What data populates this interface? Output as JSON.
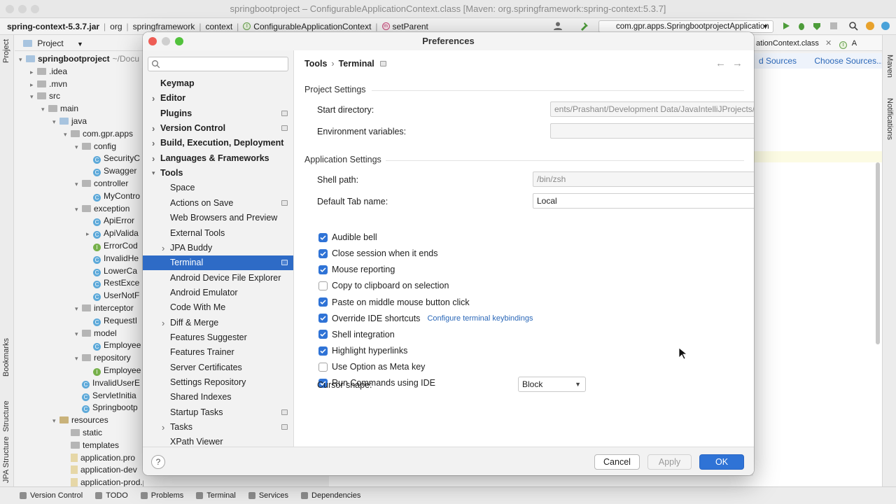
{
  "ide": {
    "window_title": "springbootproject – ConfigurableApplicationContext.class [Maven: org.springframework:spring-context:5.3.7]",
    "breadcrumbs": [
      "spring-context-5.3.7.jar",
      "org",
      "springframework",
      "context",
      "ConfigurableApplicationContext",
      "setParent"
    ],
    "run_config": "com.gpr.apps.SpringbootprojectApplication",
    "project_label": "Project",
    "left_tools": [
      "Project",
      "Bookmarks",
      "Structure",
      "JPA Structure"
    ],
    "right_tools": [
      "Maven",
      "Notifications"
    ],
    "editor_tab": "ationContext.class",
    "editor_tab2": "A",
    "editor_info": [
      "d Sources",
      "Choose Sources..."
    ],
    "tree": [
      {
        "label": "springbootproject",
        "suffix": "~/Docu",
        "indent": 0,
        "icon": "folder",
        "bold": true,
        "arrow": "v"
      },
      {
        "label": ".idea",
        "indent": 1,
        "icon": "folder-gray",
        "arrow": ">"
      },
      {
        "label": ".mvn",
        "indent": 1,
        "icon": "folder-gray",
        "arrow": ">"
      },
      {
        "label": "src",
        "indent": 1,
        "icon": "folder-gray",
        "arrow": "v"
      },
      {
        "label": "main",
        "indent": 2,
        "icon": "folder-gray",
        "arrow": "v"
      },
      {
        "label": "java",
        "indent": 3,
        "icon": "folder",
        "arrow": "v"
      },
      {
        "label": "com.gpr.apps",
        "indent": 4,
        "icon": "folder-gray",
        "arrow": "v"
      },
      {
        "label": "config",
        "indent": 5,
        "icon": "folder-gray",
        "arrow": "v"
      },
      {
        "label": "SecurityC",
        "indent": 6,
        "icon": "class"
      },
      {
        "label": "Swagger",
        "indent": 6,
        "icon": "class"
      },
      {
        "label": "controller",
        "indent": 5,
        "icon": "folder-gray",
        "arrow": "v"
      },
      {
        "label": "MyContro",
        "indent": 6,
        "icon": "class"
      },
      {
        "label": "exception",
        "indent": 5,
        "icon": "folder-gray",
        "arrow": "v"
      },
      {
        "label": "ApiError",
        "indent": 6,
        "icon": "class"
      },
      {
        "label": "ApiValida",
        "indent": 6,
        "icon": "class",
        "arrow": ">"
      },
      {
        "label": "ErrorCod",
        "indent": 6,
        "icon": "interface"
      },
      {
        "label": "InvalidHe",
        "indent": 6,
        "icon": "class"
      },
      {
        "label": "LowerCa",
        "indent": 6,
        "icon": "class"
      },
      {
        "label": "RestExce",
        "indent": 6,
        "icon": "class"
      },
      {
        "label": "UserNotF",
        "indent": 6,
        "icon": "class"
      },
      {
        "label": "interceptor",
        "indent": 5,
        "icon": "folder-gray",
        "arrow": "v"
      },
      {
        "label": "RequestI",
        "indent": 6,
        "icon": "class"
      },
      {
        "label": "model",
        "indent": 5,
        "icon": "folder-gray",
        "arrow": "v"
      },
      {
        "label": "Employee",
        "indent": 6,
        "icon": "class"
      },
      {
        "label": "repository",
        "indent": 5,
        "icon": "folder-gray",
        "arrow": "v"
      },
      {
        "label": "Employee",
        "indent": 6,
        "icon": "interface"
      },
      {
        "label": "InvalidUserE",
        "indent": 5,
        "icon": "class"
      },
      {
        "label": "ServletInitia",
        "indent": 5,
        "icon": "class"
      },
      {
        "label": "Springbootp",
        "indent": 5,
        "icon": "class"
      },
      {
        "label": "resources",
        "indent": 3,
        "icon": "folder-res",
        "arrow": "v"
      },
      {
        "label": "static",
        "indent": 4,
        "icon": "folder-gray"
      },
      {
        "label": "templates",
        "indent": 4,
        "icon": "folder-gray"
      },
      {
        "label": "application.pro",
        "indent": 4,
        "icon": "file"
      },
      {
        "label": "application-dev",
        "indent": 4,
        "icon": "file"
      },
      {
        "label": "application-prod.properties",
        "indent": 4,
        "icon": "file"
      }
    ],
    "bottom_tabs": [
      "Version Control",
      "TODO",
      "Problems",
      "Terminal",
      "Services",
      "Dependencies"
    ]
  },
  "dialog": {
    "title": "Preferences",
    "search_placeholder": "",
    "sidebar": [
      {
        "label": "Keymap",
        "level": 0,
        "bold": true
      },
      {
        "label": "Editor",
        "level": 0,
        "bold": true,
        "arrow": ">"
      },
      {
        "label": "Plugins",
        "level": 0,
        "bold": true,
        "badge": true
      },
      {
        "label": "Version Control",
        "level": 0,
        "bold": true,
        "arrow": ">",
        "badge": true
      },
      {
        "label": "Build, Execution, Deployment",
        "level": 0,
        "bold": true,
        "arrow": ">"
      },
      {
        "label": "Languages & Frameworks",
        "level": 0,
        "bold": true,
        "arrow": ">"
      },
      {
        "label": "Tools",
        "level": 0,
        "bold": true,
        "arrow": "v"
      },
      {
        "label": "Space",
        "level": 1
      },
      {
        "label": "Actions on Save",
        "level": 1,
        "badge": true
      },
      {
        "label": "Web Browsers and Preview",
        "level": 1
      },
      {
        "label": "External Tools",
        "level": 1
      },
      {
        "label": "JPA Buddy",
        "level": 1,
        "arrow": ">"
      },
      {
        "label": "Terminal",
        "level": 1,
        "badge": true,
        "selected": true
      },
      {
        "label": "Android Device File Explorer",
        "level": 1
      },
      {
        "label": "Android Emulator",
        "level": 1
      },
      {
        "label": "Code With Me",
        "level": 1
      },
      {
        "label": "Diff & Merge",
        "level": 1,
        "arrow": ">"
      },
      {
        "label": "Features Suggester",
        "level": 1
      },
      {
        "label": "Features Trainer",
        "level": 1
      },
      {
        "label": "Server Certificates",
        "level": 1
      },
      {
        "label": "Settings Repository",
        "level": 1
      },
      {
        "label": "Shared Indexes",
        "level": 1
      },
      {
        "label": "Startup Tasks",
        "level": 1,
        "badge": true
      },
      {
        "label": "Tasks",
        "level": 1,
        "arrow": ">",
        "badge": true
      },
      {
        "label": "XPath Viewer",
        "level": 1
      }
    ],
    "breadcrumb": {
      "parent": "Tools",
      "current": "Terminal"
    },
    "project_settings": {
      "header": "Project Settings",
      "start_dir_label": "Start directory:",
      "start_dir_value": "ents/Prashant/Development Data/JavaIntelliJProjects/JavaDemo/springbootproject",
      "env_label": "Environment variables:",
      "env_value": ""
    },
    "app_settings": {
      "header": "Application Settings",
      "shell_label": "Shell path:",
      "shell_value": "/bin/zsh",
      "browse_label": "...",
      "tab_label": "Default Tab name:",
      "tab_value": "Local",
      "checkboxes": [
        {
          "label": "Audible bell",
          "checked": true
        },
        {
          "label": "Close session when it ends",
          "checked": true
        },
        {
          "label": "Mouse reporting",
          "checked": true
        },
        {
          "label": "Copy to clipboard on selection",
          "checked": false
        },
        {
          "label": "Paste on middle mouse button click",
          "checked": true
        },
        {
          "label": "Override IDE shortcuts",
          "checked": true,
          "link": "Configure terminal keybindings"
        },
        {
          "label": "Shell integration",
          "checked": true
        },
        {
          "label": "Highlight hyperlinks",
          "checked": true
        },
        {
          "label": "Use Option as Meta key",
          "checked": false
        },
        {
          "label": "Run Commands using IDE",
          "checked": true
        }
      ],
      "cursor_label": "Cursor shape:",
      "cursor_value": "Block"
    },
    "buttons": {
      "help": "?",
      "cancel": "Cancel",
      "apply": "Apply",
      "ok": "OK"
    }
  },
  "colors": {
    "accent": "#2f73d6",
    "selection": "#2e6bc6",
    "link": "#2a67b8"
  }
}
